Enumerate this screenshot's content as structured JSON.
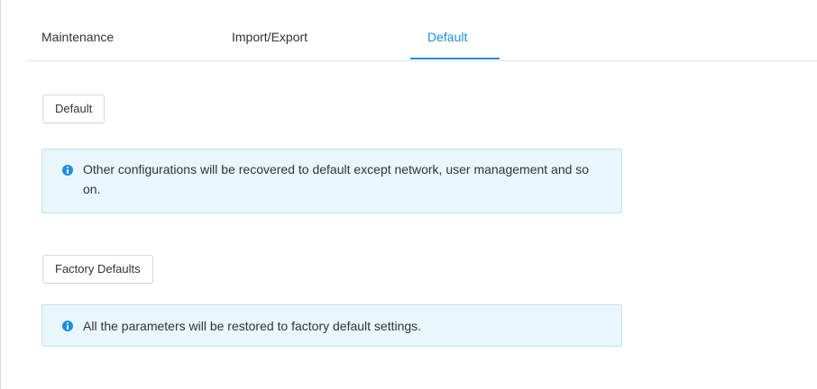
{
  "tabs": [
    {
      "label": "Maintenance",
      "active": false
    },
    {
      "label": "Import/Export",
      "active": false
    },
    {
      "label": "Default",
      "active": true
    }
  ],
  "default_section": {
    "button_label": "Default",
    "notice_text": "Other configurations will be recovered to default except network, user management and so on."
  },
  "factory_section": {
    "button_label": "Factory Defaults",
    "notice_text": "All the parameters will be restored to factory default settings."
  },
  "colors": {
    "accent": "#1c8ee3",
    "notice_background": "#e9f6fd",
    "notice_border": "#bfe3f8"
  },
  "icons": {
    "notice": "info-icon"
  }
}
